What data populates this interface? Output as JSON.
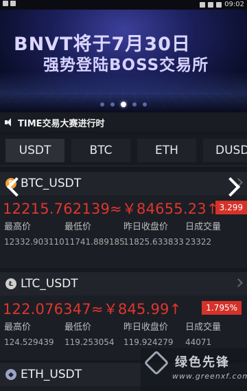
{
  "status_bar": {
    "time": "09:02"
  },
  "banner": {
    "line1": "BNVT将于7月30日",
    "line2": "强势登陆BOSS交易所"
  },
  "notice": {
    "text": "TIME交易大赛进行时"
  },
  "tabs": [
    {
      "label": "USDT",
      "selected": true
    },
    {
      "label": "BTC"
    },
    {
      "label": "ETH"
    },
    {
      "label": "DUSD"
    }
  ],
  "markets": [
    {
      "pair": "BTC_USDT",
      "price": "12215.762139≈￥84655.23↑",
      "change": "3.299",
      "stats": [
        {
          "label": "最高价",
          "value": "12332.903110"
        },
        {
          "label": "最低价",
          "value": "11741.889185"
        },
        {
          "label": "昨日收盘价",
          "value": "11825.633833"
        },
        {
          "label": "日成交量",
          "value": "23322"
        }
      ]
    },
    {
      "pair": "LTC_USDT",
      "price": "122.076347≈￥845.99↑",
      "change": "1.795%",
      "stats": [
        {
          "label": "最高价",
          "value": "124.529439"
        },
        {
          "label": "最低价",
          "value": "119.253054"
        },
        {
          "label": "昨日收盘价",
          "value": "119.924279"
        },
        {
          "label": "日成交量",
          "value": "44071"
        }
      ]
    },
    {
      "pair": "ETH_USDT"
    }
  ],
  "watermark": {
    "title": "绿色先锋",
    "url": "www.greenxf.com"
  }
}
